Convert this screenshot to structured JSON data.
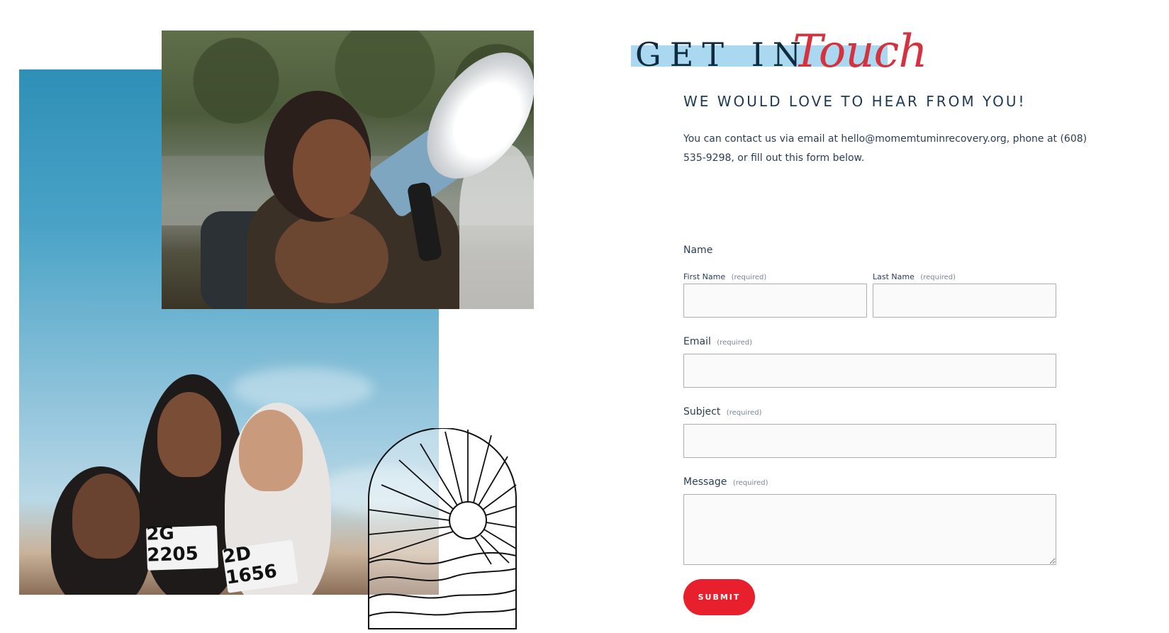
{
  "header": {
    "title_serif": "GET IN",
    "title_script": "Touch",
    "highlight_color": "#a9d8f0",
    "script_color": "#d4323f"
  },
  "subheading": "WE WOULD LOVE TO HEAR FROM YOU!",
  "intro": "You can contact us via email at hello@momemtuminrecovery.org, phone at (608) 535-9298, or fill out this form below.",
  "collage": {
    "bib_left": "2G 2205",
    "bib_right": "2D 1656"
  },
  "form": {
    "name_label": "Name",
    "first_name_label": "First Name",
    "last_name_label": "Last Name",
    "email_label": "Email",
    "subject_label": "Subject",
    "message_label": "Message",
    "required_text": "(required)",
    "first_name_value": "",
    "last_name_value": "",
    "email_value": "",
    "subject_value": "",
    "message_value": "",
    "submit_label": "SUBMIT",
    "submit_color": "#e8202e"
  }
}
